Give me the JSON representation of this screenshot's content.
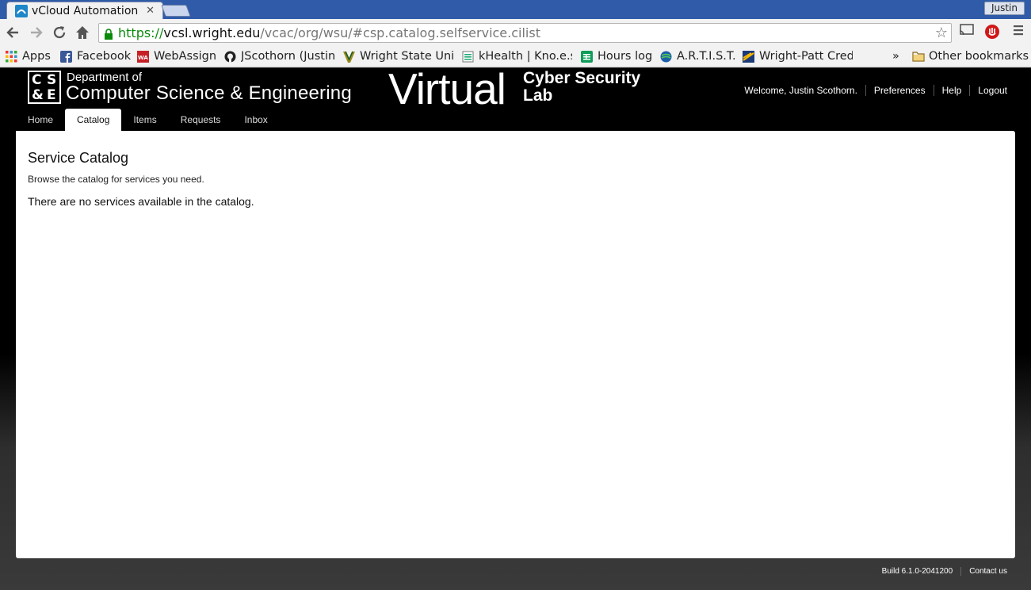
{
  "browser": {
    "tab_title": "vCloud Automation",
    "user_button": "Justin",
    "url_scheme": "https://",
    "url_host": "vcsl.wright.edu",
    "url_path": "/vcac/org/wsu/#csp.catalog.selfservice.cilist",
    "bookmarks": [
      {
        "label": "Apps",
        "icon": "apps-grid-icon"
      },
      {
        "label": "Facebook",
        "icon": "facebook-icon"
      },
      {
        "label": "WebAssign",
        "icon": "webassign-icon"
      },
      {
        "label": "JScothorn (Justin",
        "icon": "github-icon"
      },
      {
        "label": "Wright State Univ",
        "icon": "wright-state-icon"
      },
      {
        "label": "kHealth | Kno.e.si",
        "icon": "khealth-icon"
      },
      {
        "label": "Hours log",
        "icon": "sheets-icon"
      },
      {
        "label": "A.R.T.I.S.T.",
        "icon": "artist-icon"
      },
      {
        "label": "Wright-Patt Cred",
        "icon": "wright-patt-icon"
      }
    ],
    "overflow": "»",
    "other_bookmarks": "Other bookmarks"
  },
  "header": {
    "logo_letters": [
      "C",
      "S",
      "&",
      "E"
    ],
    "dept_of": "Department of",
    "dept_name": "Computer Science & Engineering",
    "virtual": "Virtual",
    "cyber_security": "Cyber Security",
    "lab": "Lab"
  },
  "user_nav": {
    "welcome": "Welcome, Justin Scothorn.",
    "preferences": "Preferences",
    "help": "Help",
    "logout": "Logout"
  },
  "nav_tabs": [
    {
      "label": "Home",
      "active": false
    },
    {
      "label": "Catalog",
      "active": true
    },
    {
      "label": "Items",
      "active": false
    },
    {
      "label": "Requests",
      "active": false
    },
    {
      "label": "Inbox",
      "active": false
    }
  ],
  "main": {
    "title": "Service Catalog",
    "subtitle": "Browse the catalog for services you need.",
    "empty_message": "There are no services available in the catalog."
  },
  "footer": {
    "build": "Build 6.1.0-2041200",
    "contact": "Contact us"
  },
  "colors": {
    "tabstrip": "#2f5ba8",
    "header_bg": "#000000",
    "url_green": "#0a8a0a"
  }
}
